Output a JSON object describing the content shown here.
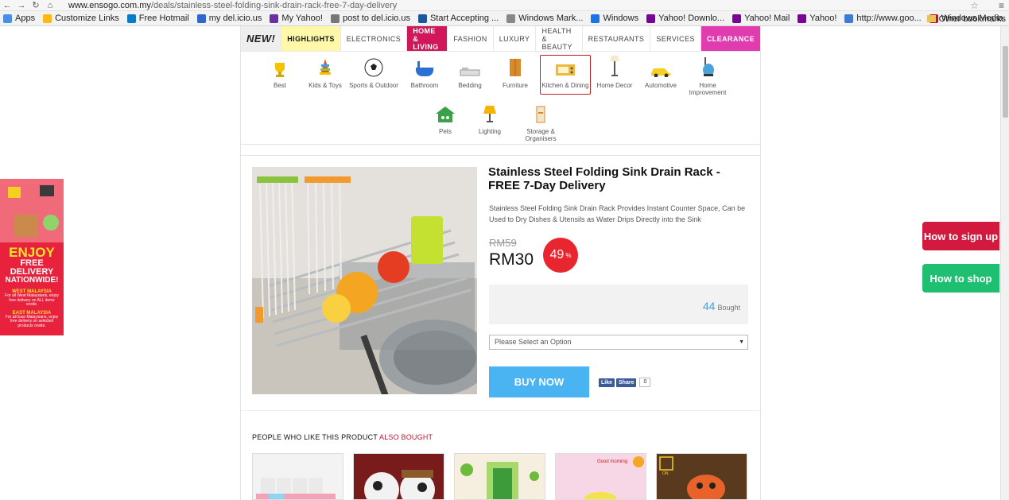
{
  "browser": {
    "url_host": "www.ensogo.com.my",
    "url_path": "/deals/stainless-steel-folding-sink-drain-rack-free-7-day-delivery",
    "bookmarks": [
      "Apps",
      "Customize Links",
      "Free Hotmail",
      "my del.icio.us",
      "My Yahoo!",
      "post to del.icio.us",
      "Start Accepting ...",
      "Windows Mark...",
      "Windows",
      "Yahoo! Downlo...",
      "Yahoo! Mail",
      "Yahoo!",
      "http://www.goo...",
      "Windows Media"
    ],
    "other_bookmarks": "Other bookmarks"
  },
  "catnav": {
    "new": "NEW!",
    "items": [
      "HIGHLIGHTS",
      "ELECTRONICS",
      "HOME & LIVING",
      "FASHION",
      "LUXURY",
      "HEALTH & BEAUTY",
      "RESTAURANTS",
      "SERVICES",
      "CLEARANCE"
    ]
  },
  "subcats": [
    "Best",
    "Kids & Toys",
    "Sports & Outdoor",
    "Bathroom",
    "Bedding",
    "Furniture",
    "Kitchen & Dining",
    "Home Decor",
    "Automotive",
    "Home Improvement",
    "Pets",
    "Lighting",
    "Storage & Organisers"
  ],
  "product": {
    "title": "Stainless Steel Folding Sink Drain Rack - FREE 7-Day Delivery",
    "description": "Stainless Steel Folding Sink Drain Rack Provides Instant Counter Space, Can be Used to Dry Dishes & Utensils as Water Drips Directly into the Sink",
    "old_price": "RM59",
    "price": "RM30",
    "discount": "49",
    "discount_unit": "%",
    "bought_count": "44",
    "bought_label": "Bought",
    "option_placeholder": "Please Select an Option",
    "buy_label": "BUY NOW",
    "fb_like": "Like",
    "fb_share": "Share",
    "fb_count": "0"
  },
  "also": {
    "prefix": "PEOPLE WHO LIKE THIS PRODUCT ",
    "highlight": "ALSO BOUGHT",
    "thumb_text": "Good morning",
    "thumb_badge": "ON"
  },
  "left_banner": {
    "line1": "ENJOY",
    "line2": "FREE DELIVERY",
    "line3": "NATIONWIDE!",
    "west": "WEST MALAYSIA",
    "west_text": "For all West Malaysians, enjoy free delivery on ALL items onsite.",
    "east": "EAST MALAYSIA",
    "east_text": "For all East Malaysians, enjoy free delivery on selected products onsite."
  },
  "side_buttons": {
    "sign_up": "How to sign up",
    "shop": "How to shop"
  }
}
